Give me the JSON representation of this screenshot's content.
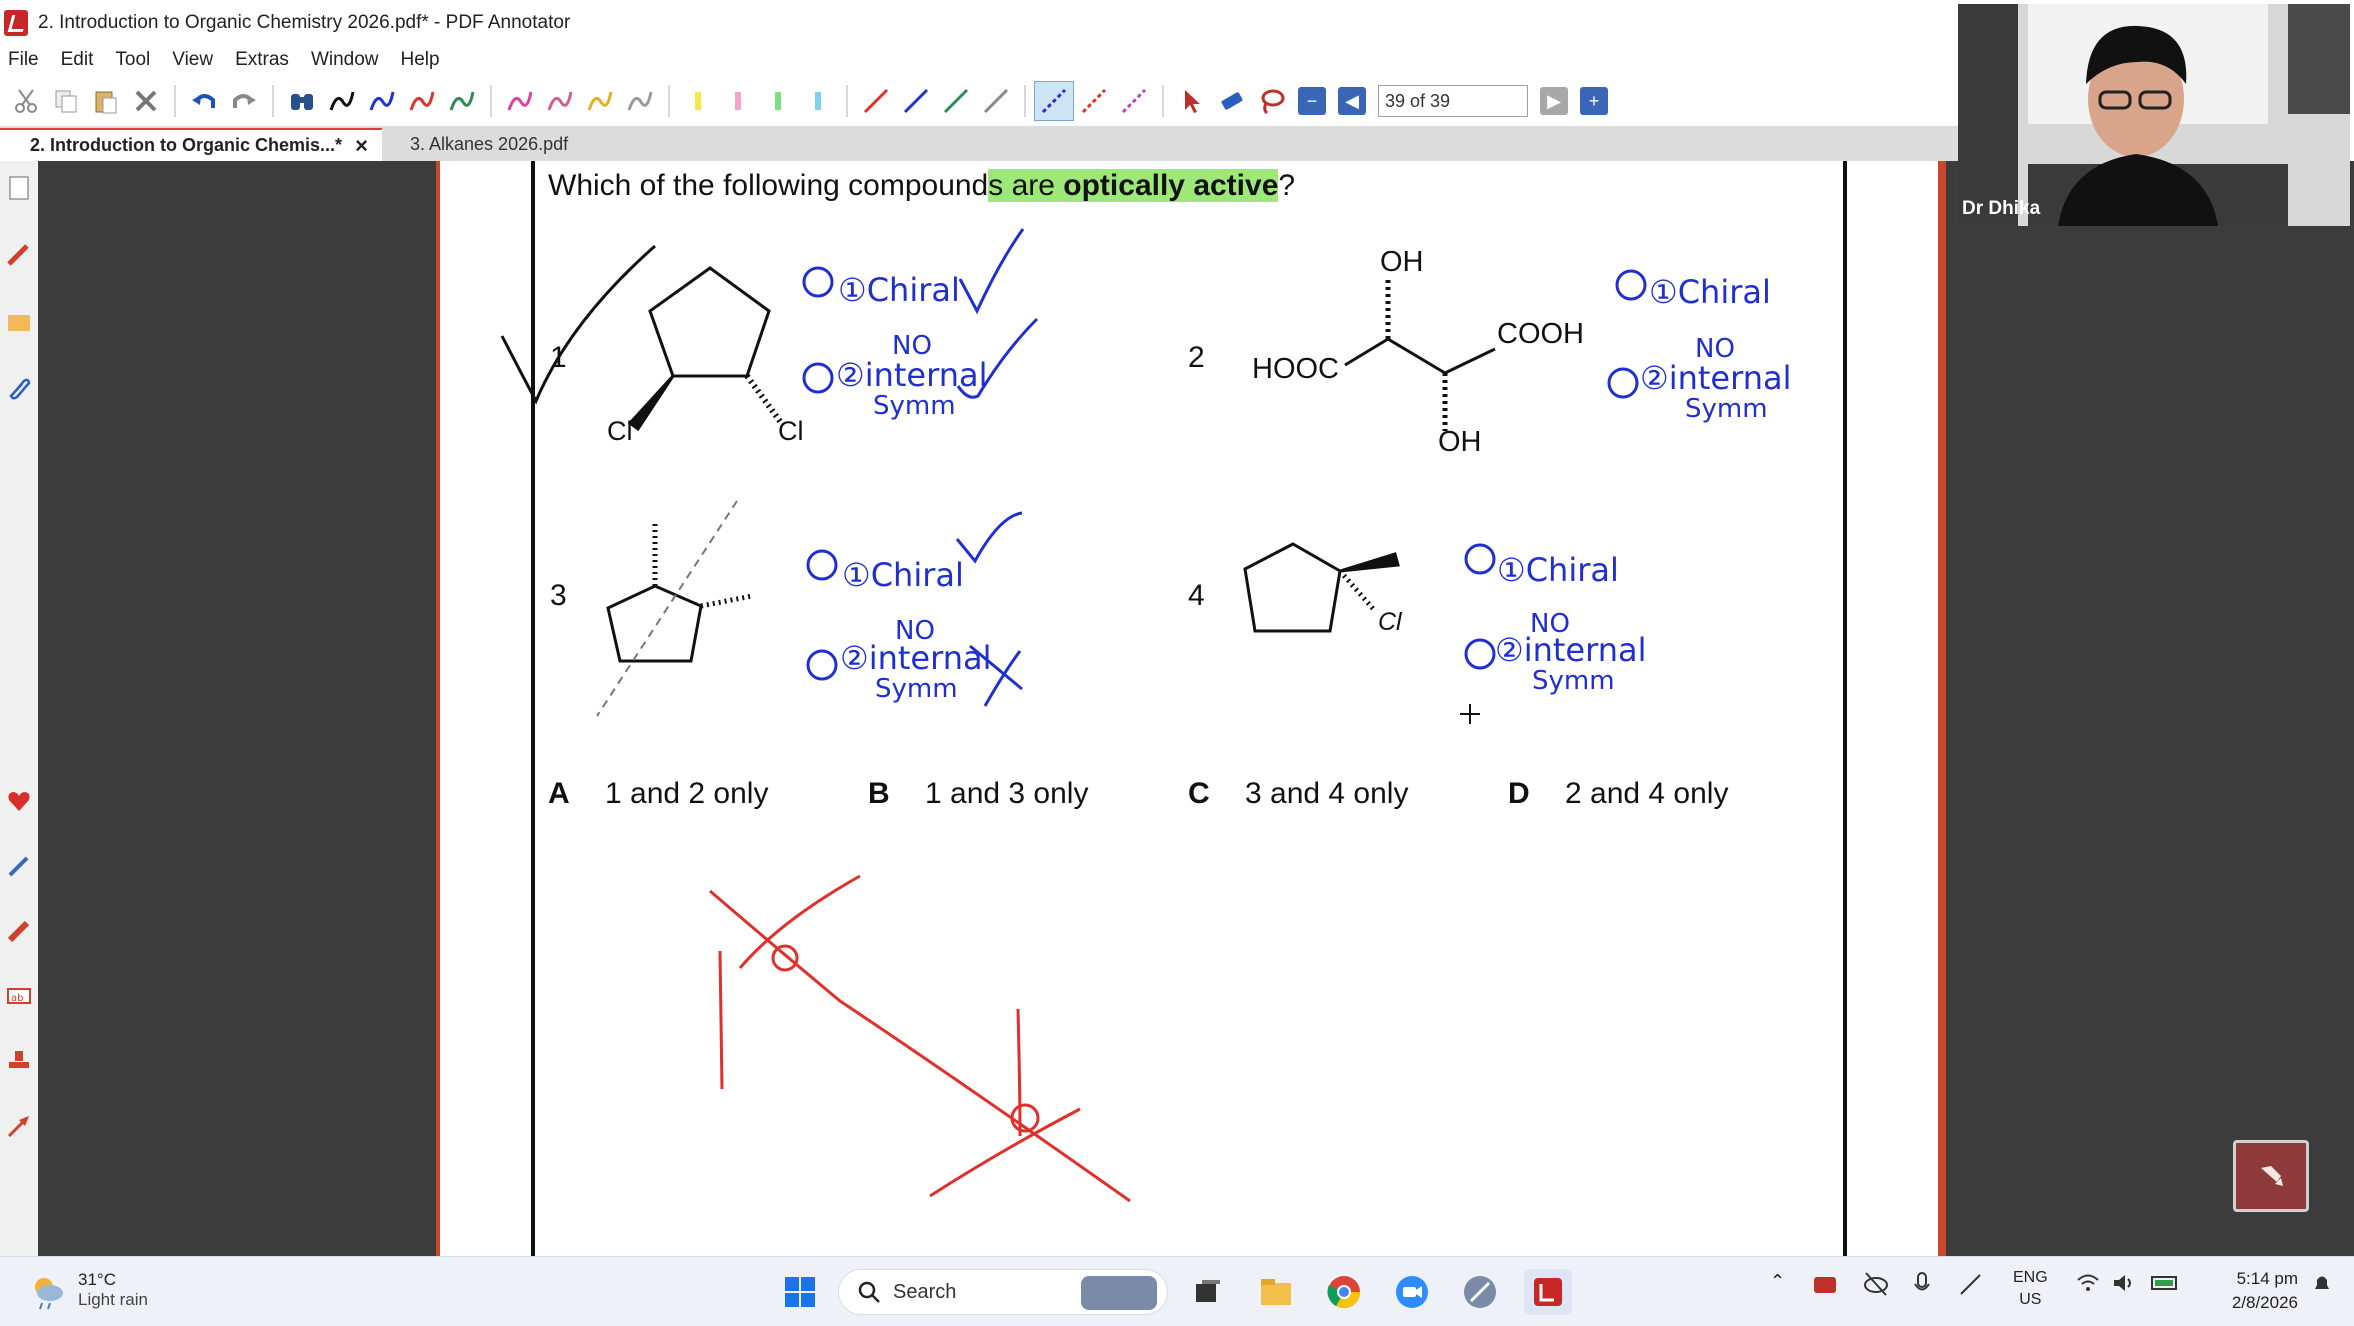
{
  "window": {
    "title": "2. Introduction to Organic Chemistry 2026.pdf* - PDF Annotator"
  },
  "menu": [
    "File",
    "Edit",
    "Tool",
    "View",
    "Extras",
    "Window",
    "Help"
  ],
  "toolbar": {
    "page_field": "39 of 39"
  },
  "tabs": [
    {
      "label": "2. Introduction to Organic Chemis...*",
      "close": "×"
    },
    {
      "label": "3. Alkanes 2026.pdf"
    }
  ],
  "question": {
    "text_before": "Which of the following compound",
    "text_highlight": "s are ",
    "text_bold": "optically active",
    "text_after": "?",
    "compounds": [
      {
        "number": "1",
        "labels": [
          "Cl",
          "Cl"
        ]
      },
      {
        "number": "2",
        "labels": [
          "OH",
          "COOH",
          "HOOC",
          "OH"
        ]
      },
      {
        "number": "3",
        "labels": []
      },
      {
        "number": "4",
        "labels": [
          "Cl"
        ]
      }
    ],
    "options": [
      {
        "letter": "A",
        "text": "1 and 2 only"
      },
      {
        "letter": "B",
        "text": "1 and 3 only"
      },
      {
        "letter": "C",
        "text": "3 and 4 only"
      },
      {
        "letter": "D",
        "text": "2 and 4 only"
      }
    ]
  },
  "annotations": {
    "handwriting": [
      "①Chiral",
      "②internal",
      "NO",
      "Symm"
    ],
    "ink_colors": {
      "blue": "#1f2fd0",
      "red": "#e0302a",
      "black": "#111111",
      "highlight": "#9ee87a"
    }
  },
  "webcam": {
    "name": "Dr Dhika"
  },
  "taskbar": {
    "weather_temp": "31°C",
    "weather_cond": "Light rain",
    "search_placeholder": "Search",
    "lang_top": "ENG",
    "lang_bottom": "US",
    "time": "5:14 pm",
    "date": "2/8/2026"
  }
}
